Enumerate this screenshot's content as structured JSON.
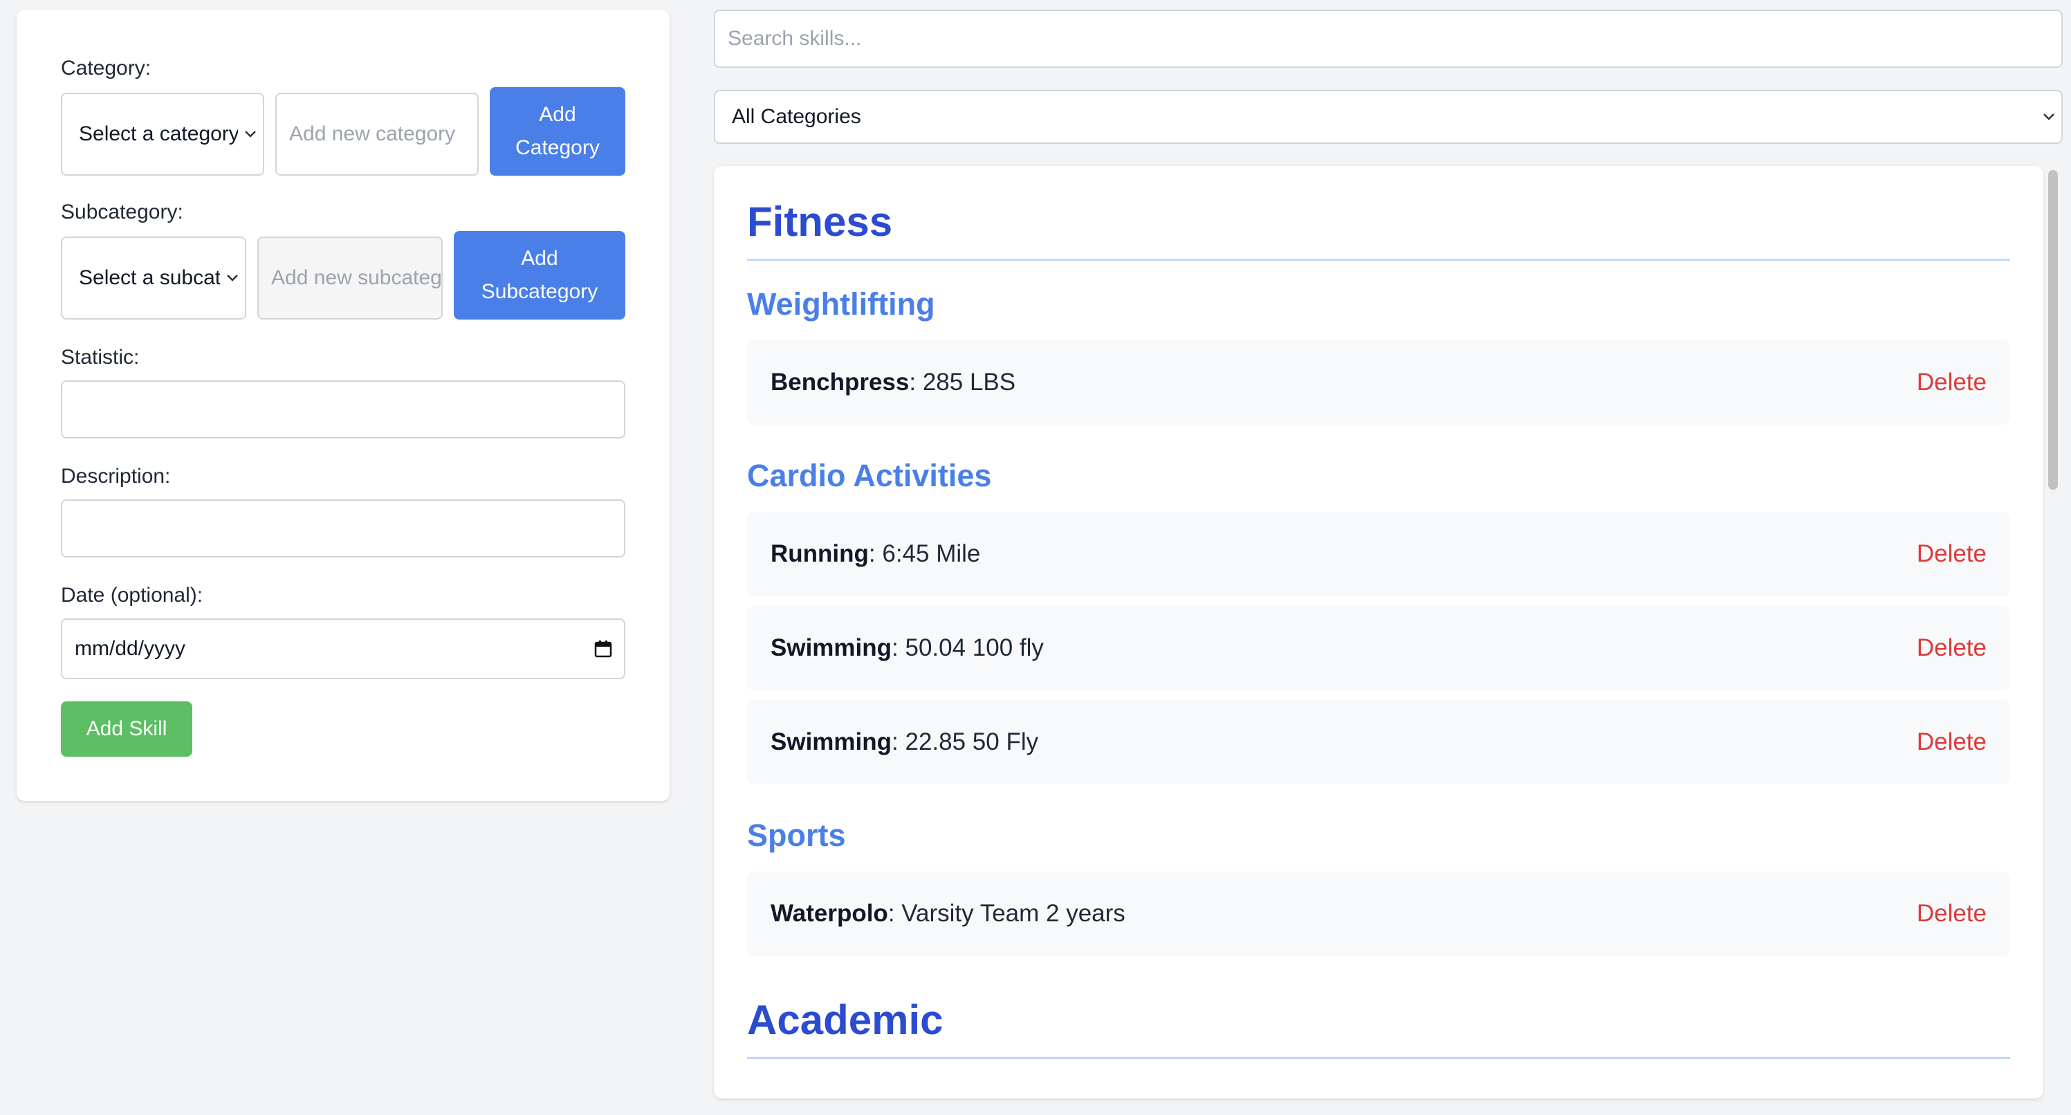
{
  "form": {
    "category_label": "Category:",
    "category_select": "Select a category",
    "category_new_placeholder": "Add new category",
    "add_category_line1": "Add",
    "add_category_line2": "Category",
    "subcategory_label": "Subcategory:",
    "subcategory_select": "Select a subcategory",
    "subcategory_new_placeholder": "Add new subcategory",
    "add_subcategory_line1": "Add",
    "add_subcategory_line2": "Subcategory",
    "statistic_label": "Statistic:",
    "statistic_value": "",
    "description_label": "Description:",
    "description_value": "",
    "date_label": "Date (optional):",
    "date_value": "mm/dd/yyyy",
    "add_skill": "Add Skill"
  },
  "search": {
    "placeholder": "Search skills..."
  },
  "filter": {
    "selected": "All Categories"
  },
  "categories": [
    {
      "name": "Fitness",
      "subcategories": [
        {
          "name": "Weightlifting",
          "skills": [
            {
              "name": "Benchpress",
              "stat": ": 285 LBS"
            }
          ]
        },
        {
          "name": "Cardio Activities",
          "skills": [
            {
              "name": "Running",
              "stat": ": 6:45 Mile"
            },
            {
              "name": "Swimming",
              "stat": ": 50.04 100 fly"
            },
            {
              "name": "Swimming",
              "stat": ": 22.85 50 Fly"
            }
          ]
        },
        {
          "name": "Sports",
          "skills": [
            {
              "name": "Waterpolo",
              "stat": ": Varsity Team 2 years"
            }
          ]
        }
      ]
    },
    {
      "name": "Academic",
      "subcategories": []
    }
  ],
  "delete_label": "Delete",
  "colors": {
    "primary": "#4a7fe8",
    "category_title": "#2b4bd0",
    "success": "#5cbf63",
    "danger": "#dc3b3b"
  }
}
